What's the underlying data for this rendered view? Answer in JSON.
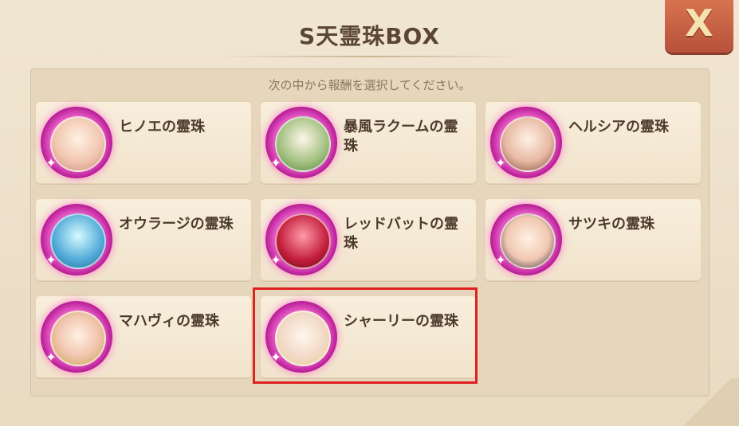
{
  "title": "S天霊珠BOX",
  "close_label": "X",
  "subtitle": "次の中から報酬を選択してください。",
  "items": [
    {
      "label": "ヒノエの霊珠"
    },
    {
      "label": "暴風ラクームの霊珠"
    },
    {
      "label": "ヘルシアの霊珠"
    },
    {
      "label": "オウラージの霊珠"
    },
    {
      "label": "レッドバットの霊珠"
    },
    {
      "label": "サツキの霊珠"
    },
    {
      "label": "マハヴィの霊珠"
    },
    {
      "label": "シャーリーの霊珠",
      "selected": true
    }
  ],
  "colors": {
    "background": "#e9dcc5",
    "card": "#f6ead5",
    "text": "#4c3b2c",
    "close_tab": "#c9613f",
    "orb_ring": "#e85bc8",
    "selection": "#e02020"
  }
}
